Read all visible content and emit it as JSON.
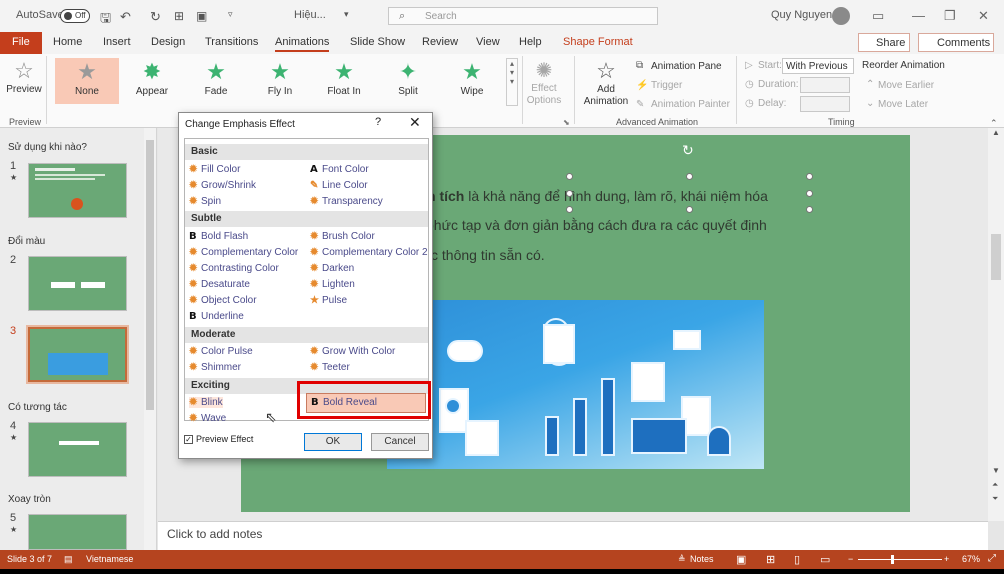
{
  "titlebar": {
    "autosave": "AutoSave",
    "toggle": "Off",
    "filename": "Hiệu...",
    "search_icon": "⌕",
    "search_placeholder": "Search",
    "user": "Quy Nguyen"
  },
  "tabs": {
    "file": "File",
    "items": [
      "Home",
      "Insert",
      "Design",
      "Transitions",
      "Animations",
      "Slide Show",
      "Review",
      "View",
      "Help"
    ],
    "shape_format": "Shape Format",
    "share": "Share",
    "comments": "Comments"
  },
  "ribbon": {
    "preview": "Preview",
    "preview_group": "Preview",
    "animations": [
      "None",
      "Appear",
      "Fade",
      "Fly In",
      "Float In",
      "Split",
      "Wipe"
    ],
    "effect_options": "Effect Options",
    "add_animation": "Add Animation",
    "animation_pane": "Animation Pane",
    "trigger": "Trigger",
    "animation_painter": "Animation Painter",
    "advanced_group": "Advanced Animation",
    "start_label": "Start:",
    "start_value": "With Previous",
    "duration_label": "Duration:",
    "delay_label": "Delay:",
    "timing_group": "Timing",
    "reorder": "Reorder Animation",
    "move_earlier": "Move Earlier",
    "move_later": "Move Later"
  },
  "slides_panel": {
    "sections": [
      "Sử dụng khi nào?",
      "Đổi màu",
      "Có tương tác",
      "Xoay tròn"
    ],
    "numbers": [
      "1",
      "2",
      "3",
      "4",
      "5"
    ]
  },
  "slide": {
    "line1_bold": "n tích",
    "line1_rest": " là khả năng để hình dung, làm rõ, khái niệm hóa",
    "line2": "phức tạp và đơn giản bằng cách đưa ra các quyết định",
    "line3": "c thông tin sẵn có."
  },
  "notes_placeholder": "Click to add notes",
  "status": {
    "slide": "Slide 3 of 7",
    "language": "Vietnamese",
    "notes": "Notes",
    "zoom": "67%"
  },
  "dialog": {
    "title": "Change Emphasis Effect",
    "help": "?",
    "categories": [
      "Basic",
      "Subtle",
      "Moderate",
      "Exciting"
    ],
    "basic": [
      "Fill Color",
      "Font Color",
      "Grow/Shrink",
      "Line Color",
      "Spin",
      "Transparency"
    ],
    "subtle": [
      "Bold Flash",
      "Brush Color",
      "Complementary Color",
      "Complementary Color 2",
      "Contrasting Color",
      "Darken",
      "Desaturate",
      "Lighten",
      "Object Color",
      "Pulse",
      "Underline"
    ],
    "moderate": [
      "Color Pulse",
      "Grow With Color",
      "Shimmer",
      "Teeter"
    ],
    "exciting": [
      "Blink",
      "Bold Reveal",
      "Wave"
    ],
    "preview_effect": "Preview Effect",
    "ok": "OK",
    "cancel": "Cancel"
  }
}
